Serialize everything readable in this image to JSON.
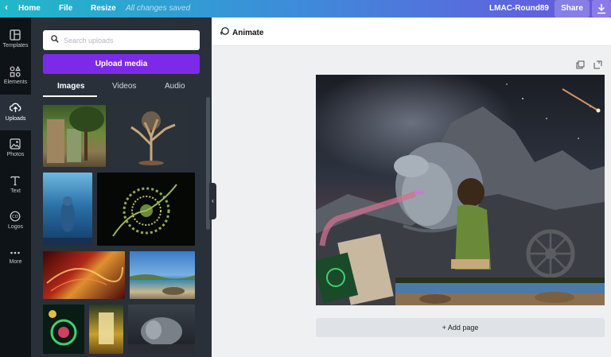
{
  "topbar": {
    "home": "Home",
    "file": "File",
    "resize": "Resize",
    "save_status": "All changes saved",
    "design_name": "LMAC-Round89",
    "share": "Share"
  },
  "rail": {
    "items": [
      {
        "label": "Templates",
        "icon": "templates-icon"
      },
      {
        "label": "Elements",
        "icon": "elements-icon"
      },
      {
        "label": "Uploads",
        "icon": "upload-cloud-icon"
      },
      {
        "label": "Photos",
        "icon": "photos-icon"
      },
      {
        "label": "Text",
        "icon": "text-icon"
      },
      {
        "label": "Logos",
        "icon": "logos-icon"
      },
      {
        "label": "More",
        "icon": "more-icon"
      }
    ],
    "active": "Uploads"
  },
  "uploads": {
    "search_placeholder": "Search uploads",
    "upload_button": "Upload media",
    "tabs": [
      "Images",
      "Videos",
      "Audio"
    ],
    "active_tab": "Images"
  },
  "toolbar": {
    "animate": "Animate"
  },
  "add_page": "+ Add page",
  "colors": {
    "accent": "#7d2ae8",
    "panel": "#293039",
    "rail": "#0e1318"
  }
}
